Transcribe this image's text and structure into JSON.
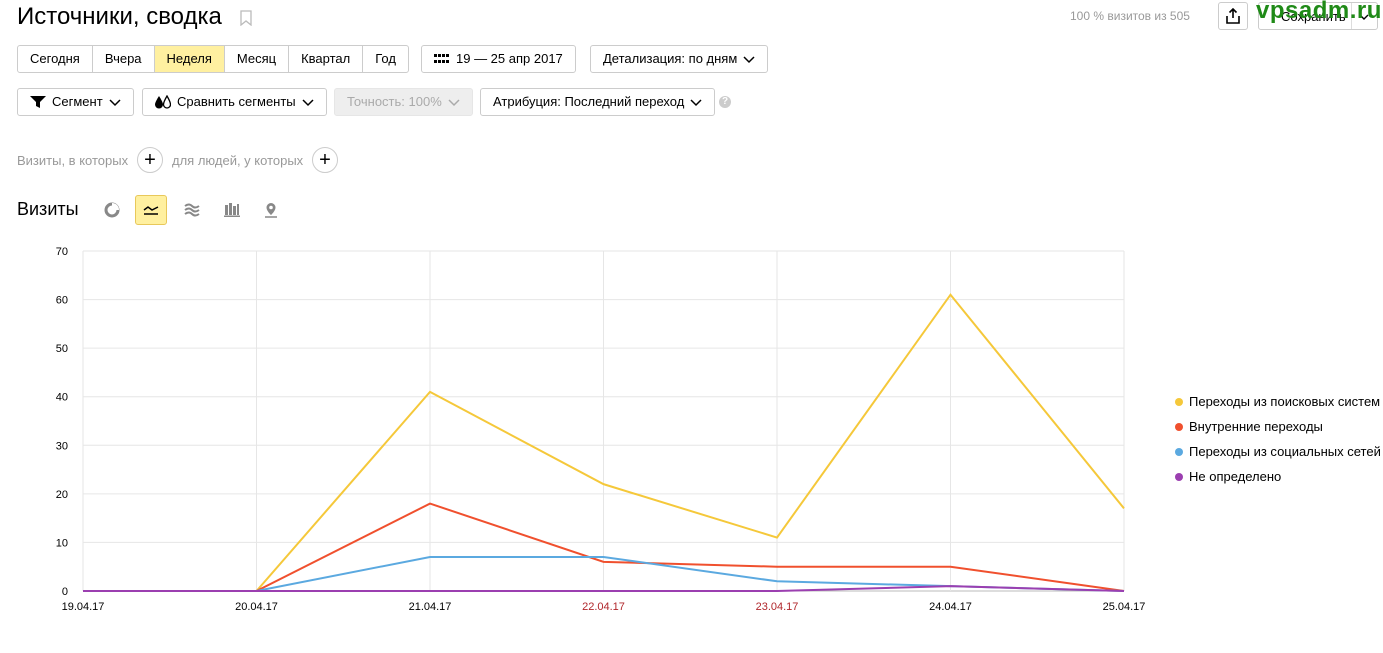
{
  "header": {
    "title": "Источники, сводка",
    "visits_info": "100 % визитов из 505",
    "save_label": "Сохранить",
    "watermark": "vpsadm.ru"
  },
  "period": {
    "options": [
      "Сегодня",
      "Вчера",
      "Неделя",
      "Месяц",
      "Квартал",
      "Год"
    ],
    "active": "Неделя"
  },
  "date_range": "19 — 25 апр 2017",
  "detail": "Детализация: по дням",
  "segment": "Сегмент",
  "compare": "Сравнить сегменты",
  "accuracy": "Точность: 100%",
  "attribution": "Атрибуция: Последний переход",
  "help": "?",
  "conditions": {
    "visits": "Визиты, в которых",
    "people": "для людей, у которых"
  },
  "chart_section": {
    "title": "Визиты",
    "view_types": [
      "pie-chart-icon",
      "line-chart-icon",
      "area-chart-icon",
      "bar-chart-icon",
      "map-icon"
    ],
    "active_view": "line-chart-icon"
  },
  "colors": {
    "search": "#f5c83a",
    "internal": "#f0502e",
    "social": "#5ba9e0",
    "undefined": "#9b3fb0",
    "weekend": "#b0262b"
  },
  "chart_data": {
    "type": "line",
    "x": [
      "19.04.17",
      "20.04.17",
      "21.04.17",
      "22.04.17",
      "23.04.17",
      "24.04.17",
      "25.04.17"
    ],
    "weekend": [
      false,
      false,
      false,
      true,
      true,
      false,
      false
    ],
    "ylim": [
      0,
      70
    ],
    "yticks": [
      0,
      10,
      20,
      30,
      40,
      50,
      60,
      70
    ],
    "grid": true,
    "legend": "right",
    "series": [
      {
        "name": "Переходы из поисковых систем",
        "color": "#f5c83a",
        "values": [
          0,
          0,
          41,
          22,
          11,
          61,
          17
        ]
      },
      {
        "name": "Внутренние переходы",
        "color": "#f0502e",
        "values": [
          0,
          0,
          18,
          6,
          5,
          5,
          0
        ]
      },
      {
        "name": "Переходы из социальных сетей",
        "color": "#5ba9e0",
        "values": [
          0,
          0,
          7,
          7,
          2,
          1,
          0
        ]
      },
      {
        "name": "Не определено",
        "color": "#9b3fb0",
        "values": [
          0,
          0,
          0,
          0,
          0,
          1,
          0
        ]
      }
    ]
  }
}
